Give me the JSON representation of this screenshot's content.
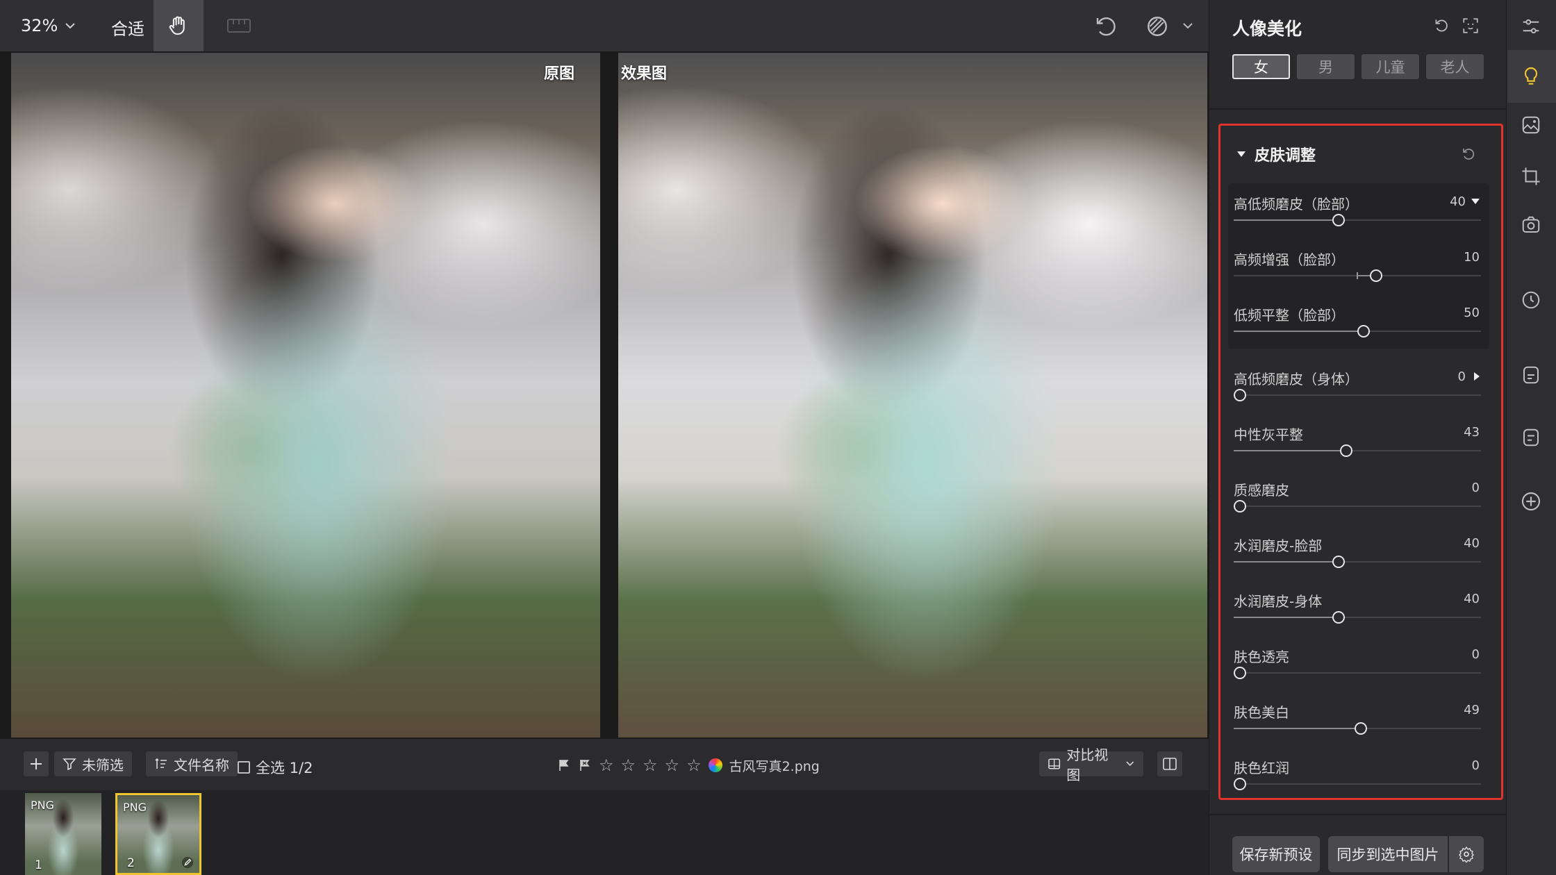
{
  "toolbar": {
    "zoom": "32%",
    "fit": "合适",
    "icons": [
      "chevron-down-icon",
      "hand-icon",
      "ruler-icon",
      "undo-icon",
      "compare-icon",
      "chevron-down-icon"
    ]
  },
  "canvas": {
    "label_original": "原图",
    "label_effect": "效果图"
  },
  "bottom_bar": {
    "add_icon": "plus-icon",
    "filter_label": "未筛选",
    "sort_label": "文件名称",
    "select_all_label": "全选 1/2",
    "file_name": "古风写真2.png",
    "compare_view_label": "对比视图",
    "stars": [
      "☆",
      "☆",
      "☆",
      "☆",
      "☆"
    ]
  },
  "filmstrip": {
    "items": [
      {
        "type": "PNG",
        "number": "1",
        "selected": false
      },
      {
        "type": "PNG",
        "number": "2",
        "selected": true
      }
    ]
  },
  "panel": {
    "title": "人像美化",
    "gender_tabs": [
      "女",
      "男",
      "儿童",
      "老人"
    ],
    "active_tab": "女",
    "section_title": "皮肤调整",
    "sliders": [
      {
        "label": "高低频磨皮（脸部）",
        "value": "40",
        "level": 0.4,
        "caret": "down"
      },
      {
        "label": "高频增强（脸部）",
        "value": "10",
        "level": 0.55,
        "center": true
      },
      {
        "label": "低频平整（脸部）",
        "value": "50",
        "level": 0.5
      },
      {
        "label": "高低频磨皮（身体）",
        "value": "0",
        "level": 0.0,
        "caret": "right"
      },
      {
        "label": "中性灰平整",
        "value": "43",
        "level": 0.43
      },
      {
        "label": "质感磨皮",
        "value": "0",
        "level": 0.0
      },
      {
        "label": "水润磨皮-脸部",
        "value": "40",
        "level": 0.4
      },
      {
        "label": "水润磨皮-身体",
        "value": "40",
        "level": 0.4
      },
      {
        "label": "肤色透亮",
        "value": "0",
        "level": 0.0
      },
      {
        "label": "肤色美白",
        "value": "49",
        "level": 0.49
      },
      {
        "label": "肤色红润",
        "value": "0",
        "level": 0.0
      }
    ],
    "footer": {
      "save_preset": "保存新预设",
      "sync": "同步到选中图片"
    }
  },
  "colors": {
    "highlight": "#e0342f",
    "selected_thumb": "#f0c630",
    "panel_bg": "#2a2a2c"
  },
  "rail": {
    "icons": [
      "sliders-icon",
      "bulb-icon",
      "photo-edit-icon",
      "crop-icon",
      "camera-icon",
      "clock-icon",
      "preset-icon",
      "preset2-icon",
      "add-circle-icon"
    ]
  }
}
